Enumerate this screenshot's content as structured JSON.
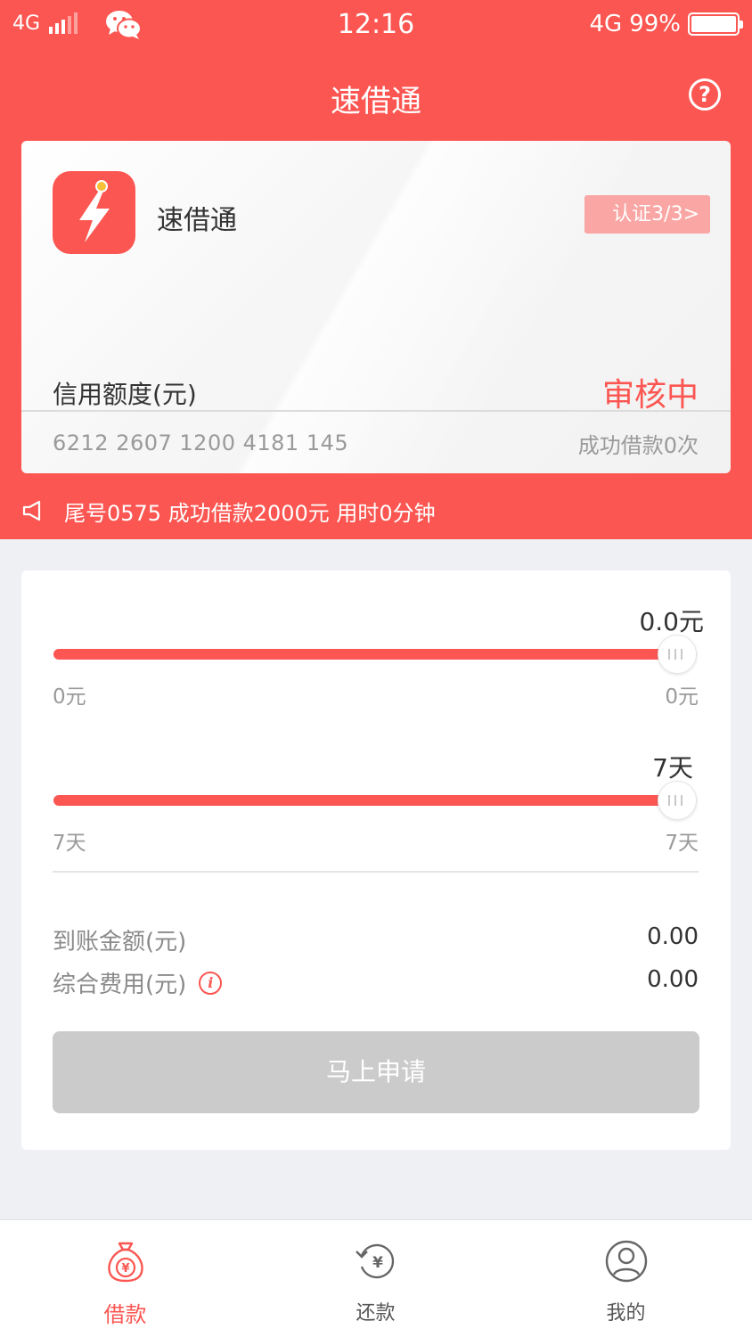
{
  "status_bar": {
    "network": "4G",
    "time": "12:16",
    "network_right": "4G",
    "battery": "99%"
  },
  "nav": {
    "title": "速借通",
    "help_icon": "question-circle-icon"
  },
  "card": {
    "app_name": "速借通",
    "cert_badge": "认证3/3>",
    "credit_label": "信用额度(元)",
    "review_status": "审核中",
    "card_number": "6212 2607 1200 4181 145",
    "success_count": "成功借款0次"
  },
  "notice": {
    "text": "尾号0575 成功借款2000元 用时0分钟"
  },
  "amount_slider": {
    "current": "0.0元",
    "min": "0元",
    "max": "0元",
    "level": 1.0
  },
  "days_slider": {
    "current": "7天",
    "min": "7天",
    "max": "7天",
    "level": 1.0
  },
  "summary": {
    "received_label": "到账金额(元)",
    "received_value": "0.00",
    "fee_label": "综合费用(元)",
    "fee_value": "0.00"
  },
  "apply_button": "马上申请",
  "tabs": [
    {
      "label": "借款",
      "icon": "money-bag-icon",
      "active": true
    },
    {
      "label": "还款",
      "icon": "repay-icon",
      "active": false
    },
    {
      "label": "我的",
      "icon": "user-icon",
      "active": false
    }
  ],
  "colors": {
    "accent": "#fb5651",
    "disabled_button": "#cbcbcb",
    "background": "#eef0f3"
  }
}
